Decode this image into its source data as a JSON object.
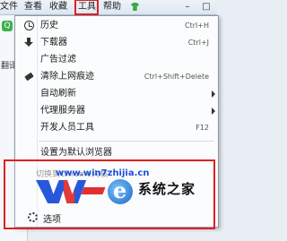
{
  "menubar": {
    "items": [
      "文件",
      "查看",
      "收藏",
      "工具",
      "帮助"
    ],
    "minimize": "–",
    "restore": "□"
  },
  "left": {
    "green_button": "Q",
    "label": "翻译"
  },
  "tools_menu": {
    "history": {
      "label": "历史",
      "shortcut": "Ctrl+H"
    },
    "downloads": {
      "label": "下载器",
      "shortcut": "Ctrl+J"
    },
    "adblock": {
      "label": "广告过滤"
    },
    "clear": {
      "label": "清除上网痕迹",
      "shortcut": "Ctrl+Shift+Delete"
    },
    "autorefresh": {
      "label": "自动刷新"
    },
    "proxy": {
      "label": "代理服务器"
    },
    "devtools": {
      "label": "开发人员工具",
      "shortcut": "F12"
    },
    "default_browser": {
      "label": "设置为默认浏览器"
    },
    "switch_kernel": {
      "label": "切换到Chrome内核"
    },
    "settings": {
      "label": "选项"
    }
  },
  "watermark": {
    "url": "www.win7zhijia.cn",
    "site": "系统之家"
  },
  "colors": {
    "highlight": "#e02020",
    "brand_blue": "#1d4fd8",
    "green": "#3ab24a"
  }
}
